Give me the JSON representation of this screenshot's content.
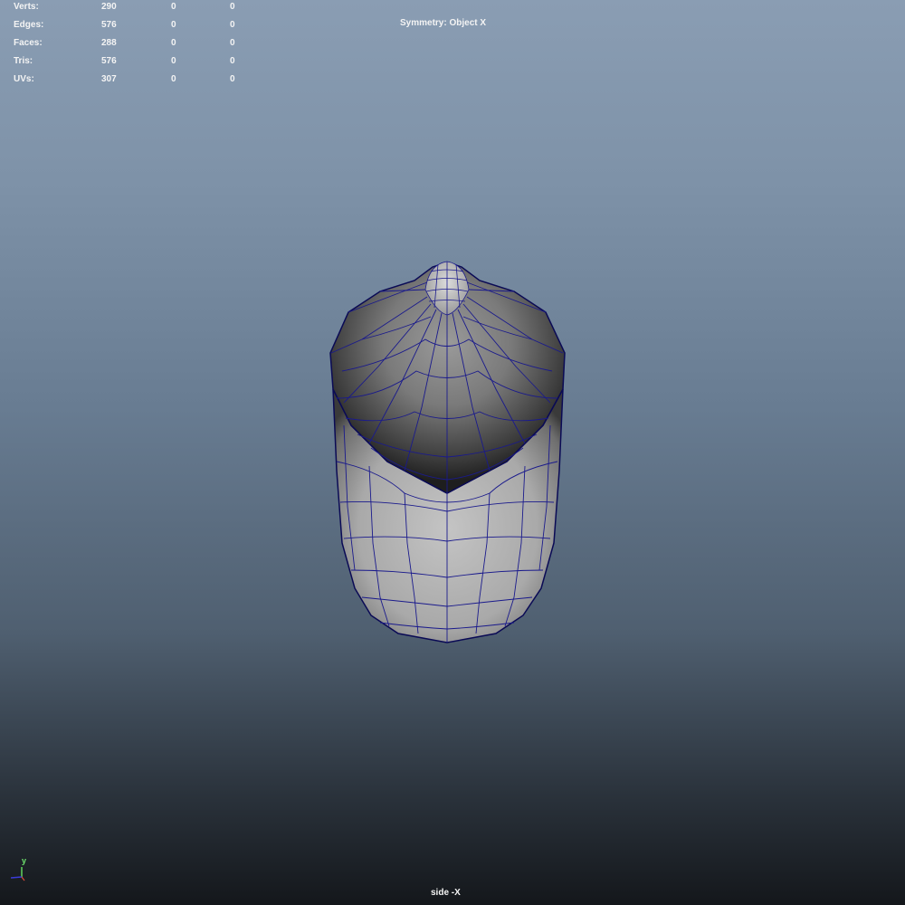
{
  "hud": {
    "rows": [
      {
        "label": "Verts:",
        "total": "290",
        "selected": "0",
        "other": "0"
      },
      {
        "label": "Edges:",
        "total": "576",
        "selected": "0",
        "other": "0"
      },
      {
        "label": "Faces:",
        "total": "288",
        "selected": "0",
        "other": "0"
      },
      {
        "label": "Tris:",
        "total": "576",
        "selected": "0",
        "other": "0"
      },
      {
        "label": "UVs:",
        "total": "307",
        "selected": "0",
        "other": "0"
      }
    ],
    "symmetry": "Symmetry: Object X"
  },
  "viewport": {
    "camera_name": "side -X",
    "axis_y_label": "y"
  },
  "colors": {
    "wireframe": "#1a1a8c",
    "mesh_light": "#b9b9b9",
    "mesh_dark": "#2b2b2b"
  },
  "icons": {
    "axis": "axis-gizmo-icon"
  }
}
